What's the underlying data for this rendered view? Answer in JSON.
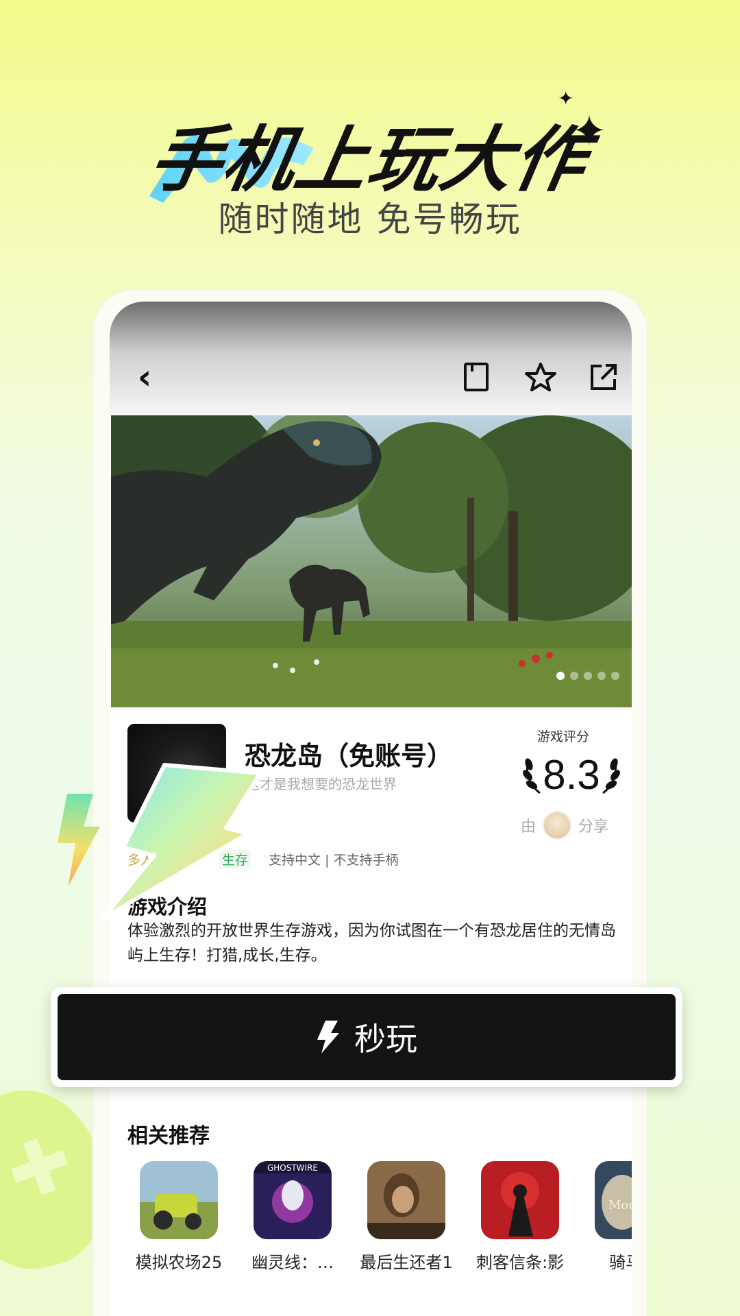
{
  "hero": {
    "title": "手机上玩大作",
    "subtitle": "随时随地 免号畅玩"
  },
  "header": {
    "icons": [
      "back-icon",
      "bookmark-icon",
      "star-icon",
      "share-icon"
    ]
  },
  "banner": {
    "dots_total": 5,
    "active_dot": 1
  },
  "game": {
    "title": "恐龙岛（免账号）",
    "tagline": "这才是我想要的恐龙世界",
    "rating_label": "游戏评分",
    "rating": "8.3",
    "shared_by_prefix": "由",
    "shared_by_suffix": "分享",
    "tags": {
      "multi": "多人",
      "survival": "生存",
      "language": "支持中文 | 不支持手柄"
    }
  },
  "intro": {
    "heading": "游戏介绍",
    "text": "体验激烈的开放世界生存游戏，因为你试图在一个有恐龙居住的无情岛屿上生存！打猎,成长,生存。"
  },
  "play_button": {
    "label": "秒玩"
  },
  "related": {
    "heading": "相关推荐",
    "items": [
      {
        "name": "模拟农场25",
        "color": "#b7c86a"
      },
      {
        "name": "幽灵线：…",
        "color": "#3a2c6e"
      },
      {
        "name": "最后生还者1",
        "color": "#7a5a3c"
      },
      {
        "name": "刺客信条:影",
        "color": "#b81e22"
      },
      {
        "name": "骑马与",
        "color": "#34495e"
      }
    ]
  },
  "colors": {
    "accent_green": "#37a85a",
    "button_dark": "#111413",
    "background_top": "#f2fb8a"
  }
}
